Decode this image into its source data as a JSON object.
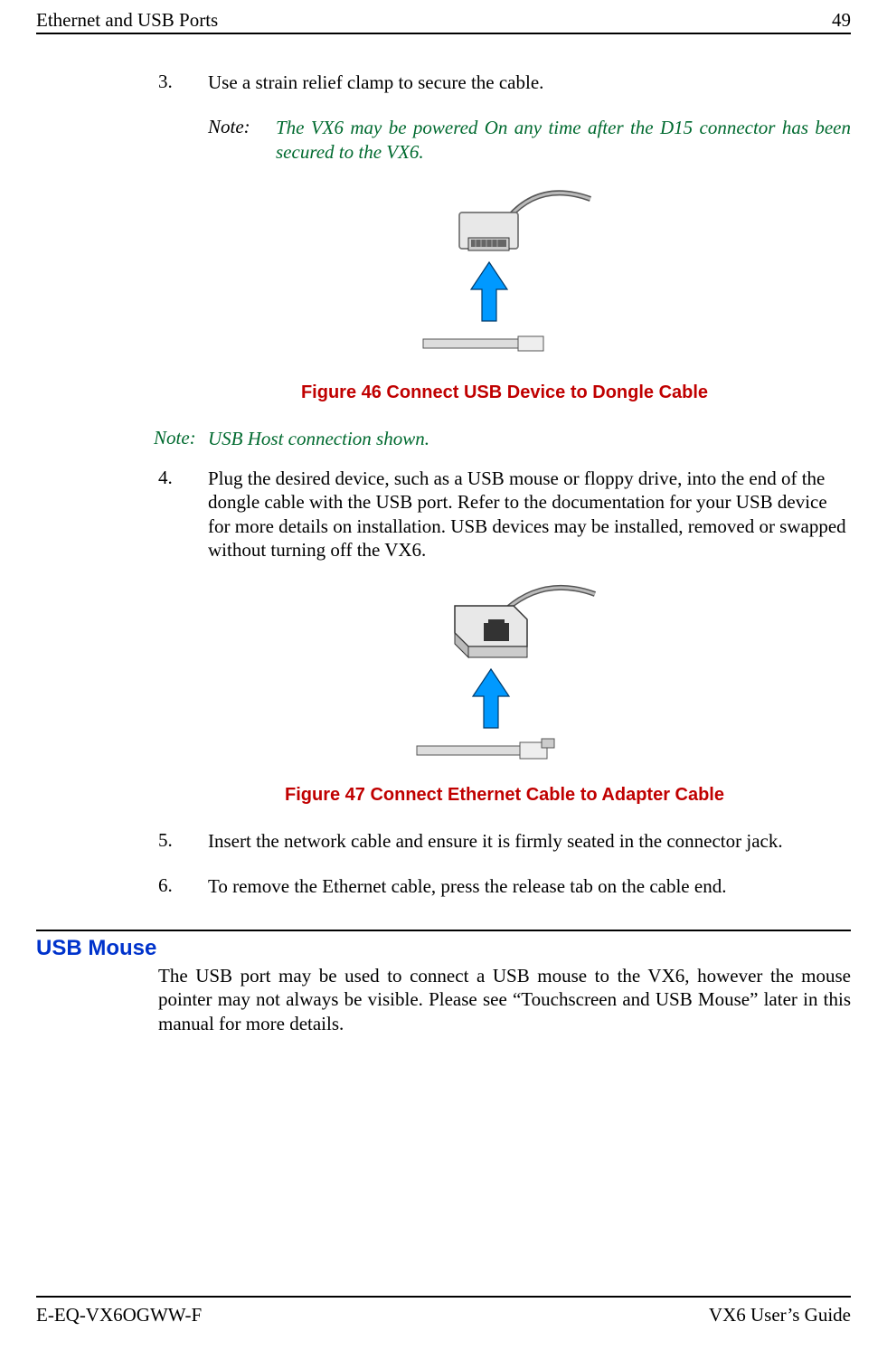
{
  "header": {
    "left": "Ethernet and USB Ports",
    "right": "49"
  },
  "body": {
    "item3_num": "3.",
    "item3_text": "Use a strain relief clamp to secure the cable.",
    "note1_label": "Note:",
    "note1_text": "The VX6 may be powered On any time after the D15 connector has been secured to the VX6.",
    "fig46_caption": "Figure 46  Connect USB Device to Dongle Cable",
    "note2_label": "Note:",
    "note2_text": "USB Host connection shown.",
    "item4_num": "4.",
    "item4_text": "Plug the desired device, such as a USB mouse or floppy drive, into the end of the dongle cable with the USB port.  Refer to the documentation for your USB device for more details on installation.  USB devices may be installed, removed or swapped without turning off the VX6.",
    "fig47_caption": "Figure 47  Connect Ethernet Cable to Adapter Cable",
    "item5_num": "5.",
    "item5_text": "Insert the network cable and ensure it is firmly seated in the connector jack.",
    "item6_num": "6.",
    "item6_text": "To remove the Ethernet cable, press the release tab on the cable end."
  },
  "section": {
    "heading": "USB Mouse",
    "text": "The USB port may be used to connect a USB mouse to the VX6, however the mouse pointer may not always be visible.  Please see “Touchscreen and USB Mouse” later in this manual for more details."
  },
  "footer": {
    "left": "E-EQ-VX6OGWW-F",
    "right": "VX6 User’s Guide"
  }
}
